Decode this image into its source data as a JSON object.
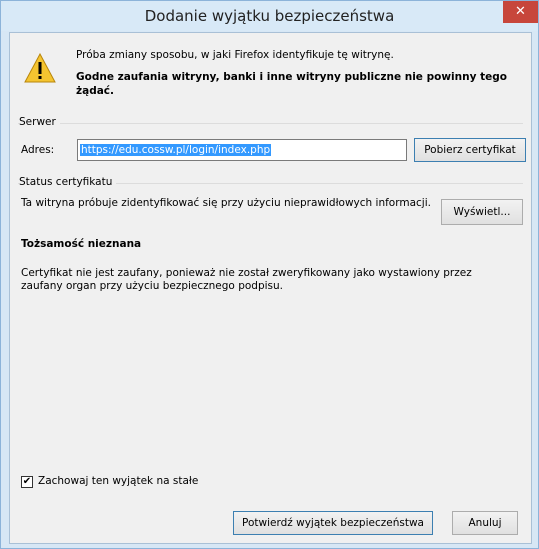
{
  "window": {
    "title": "Dodanie wyjątku bezpieczeństwa",
    "close": "✕"
  },
  "message": {
    "line1": "Próba zmiany sposobu, w jaki Firefox identyfikuje tę witrynę.",
    "line2": "Godne zaufania witryny, banki i inne witryny publiczne nie powinny tego żądać."
  },
  "server": {
    "group_label": "Serwer",
    "address_label": "Adres:",
    "address_value": "https://edu.cossw.pl/login/index.php",
    "fetch_button": "Pobierz certyfikat"
  },
  "status": {
    "group_label": "Status certyfikatu",
    "text": "Ta witryna próbuje zidentyfikować się przy użyciu nieprawidłowych informacji.",
    "view_button": "Wyświetl...",
    "identity": "Tożsamość nieznana",
    "cert_text": "Certyfikat nie jest zaufany, ponieważ nie został zweryfikowany jako wystawiony przez zaufany organ przy użyciu bezpiecznego podpisu."
  },
  "footer": {
    "permanent_checkbox_label": "Zachowaj ten wyjątek na stałe",
    "permanent_checked": true,
    "confirm_button": "Potwierdź wyjątek bezpieczeństwa",
    "cancel_button": "Anuluj"
  },
  "colors": {
    "titlebar": "#d8e9f7",
    "close": "#c7463b",
    "selection": "#3399ff",
    "dialog_bg": "#f0f0f0"
  }
}
